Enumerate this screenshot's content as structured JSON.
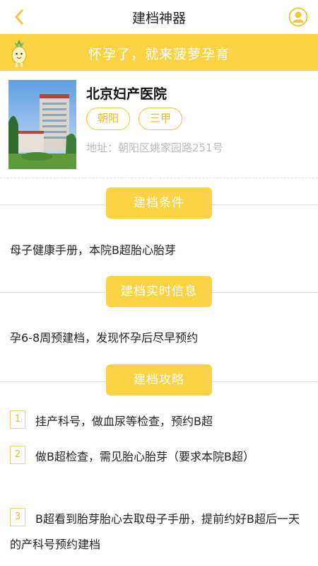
{
  "nav": {
    "title": "建档神器",
    "back_icon": "chevron-left-icon",
    "profile_icon": "user-avatar-icon",
    "accent": "#fbd243"
  },
  "banner": {
    "text": "怀孕了，就来菠萝孕育",
    "mascot_icon": "pineapple-mascot-icon"
  },
  "hospital": {
    "name": "北京妇产医院",
    "tags": [
      "朝阳",
      "三甲"
    ],
    "address": "地址：朝阳区姚家园路251号"
  },
  "sections": {
    "conditions": {
      "title": "建档条件",
      "text": "母子健康手册，本院B超胎心胎芽"
    },
    "realtime": {
      "title": "建档实时信息",
      "text": "孕6-8周预建档，发现怀孕后尽早预约"
    },
    "guide": {
      "title": "建档攻略",
      "steps": [
        {
          "num": "1",
          "text": "挂产科号，做血尿等检查，预约B超"
        },
        {
          "num": "2",
          "text": "做B超检查，需见胎心胎芽（要求本院B超）"
        },
        {
          "num": "3",
          "text": "B超看到胎芽胎心去取母子手册，提前约好B超后一天的产科号预约建档"
        }
      ]
    }
  }
}
